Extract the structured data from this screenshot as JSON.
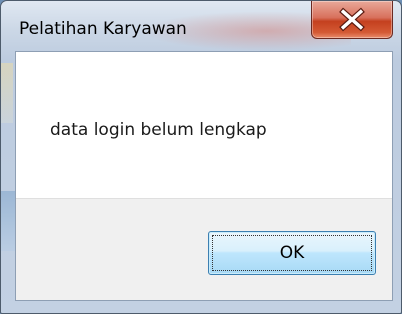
{
  "window": {
    "title": "Pelatihan Karyawan",
    "close_icon": "close-x-icon",
    "close_button_color": "#c7432a"
  },
  "message": {
    "text": "data login belum lengkap"
  },
  "buttons": {
    "ok_label": "OK"
  },
  "colors": {
    "frame_tint": "#c3d1e3",
    "client_background": "#ffffff",
    "button_panel_background": "#f0f0f0",
    "ok_button_border": "#3c7fb1"
  }
}
